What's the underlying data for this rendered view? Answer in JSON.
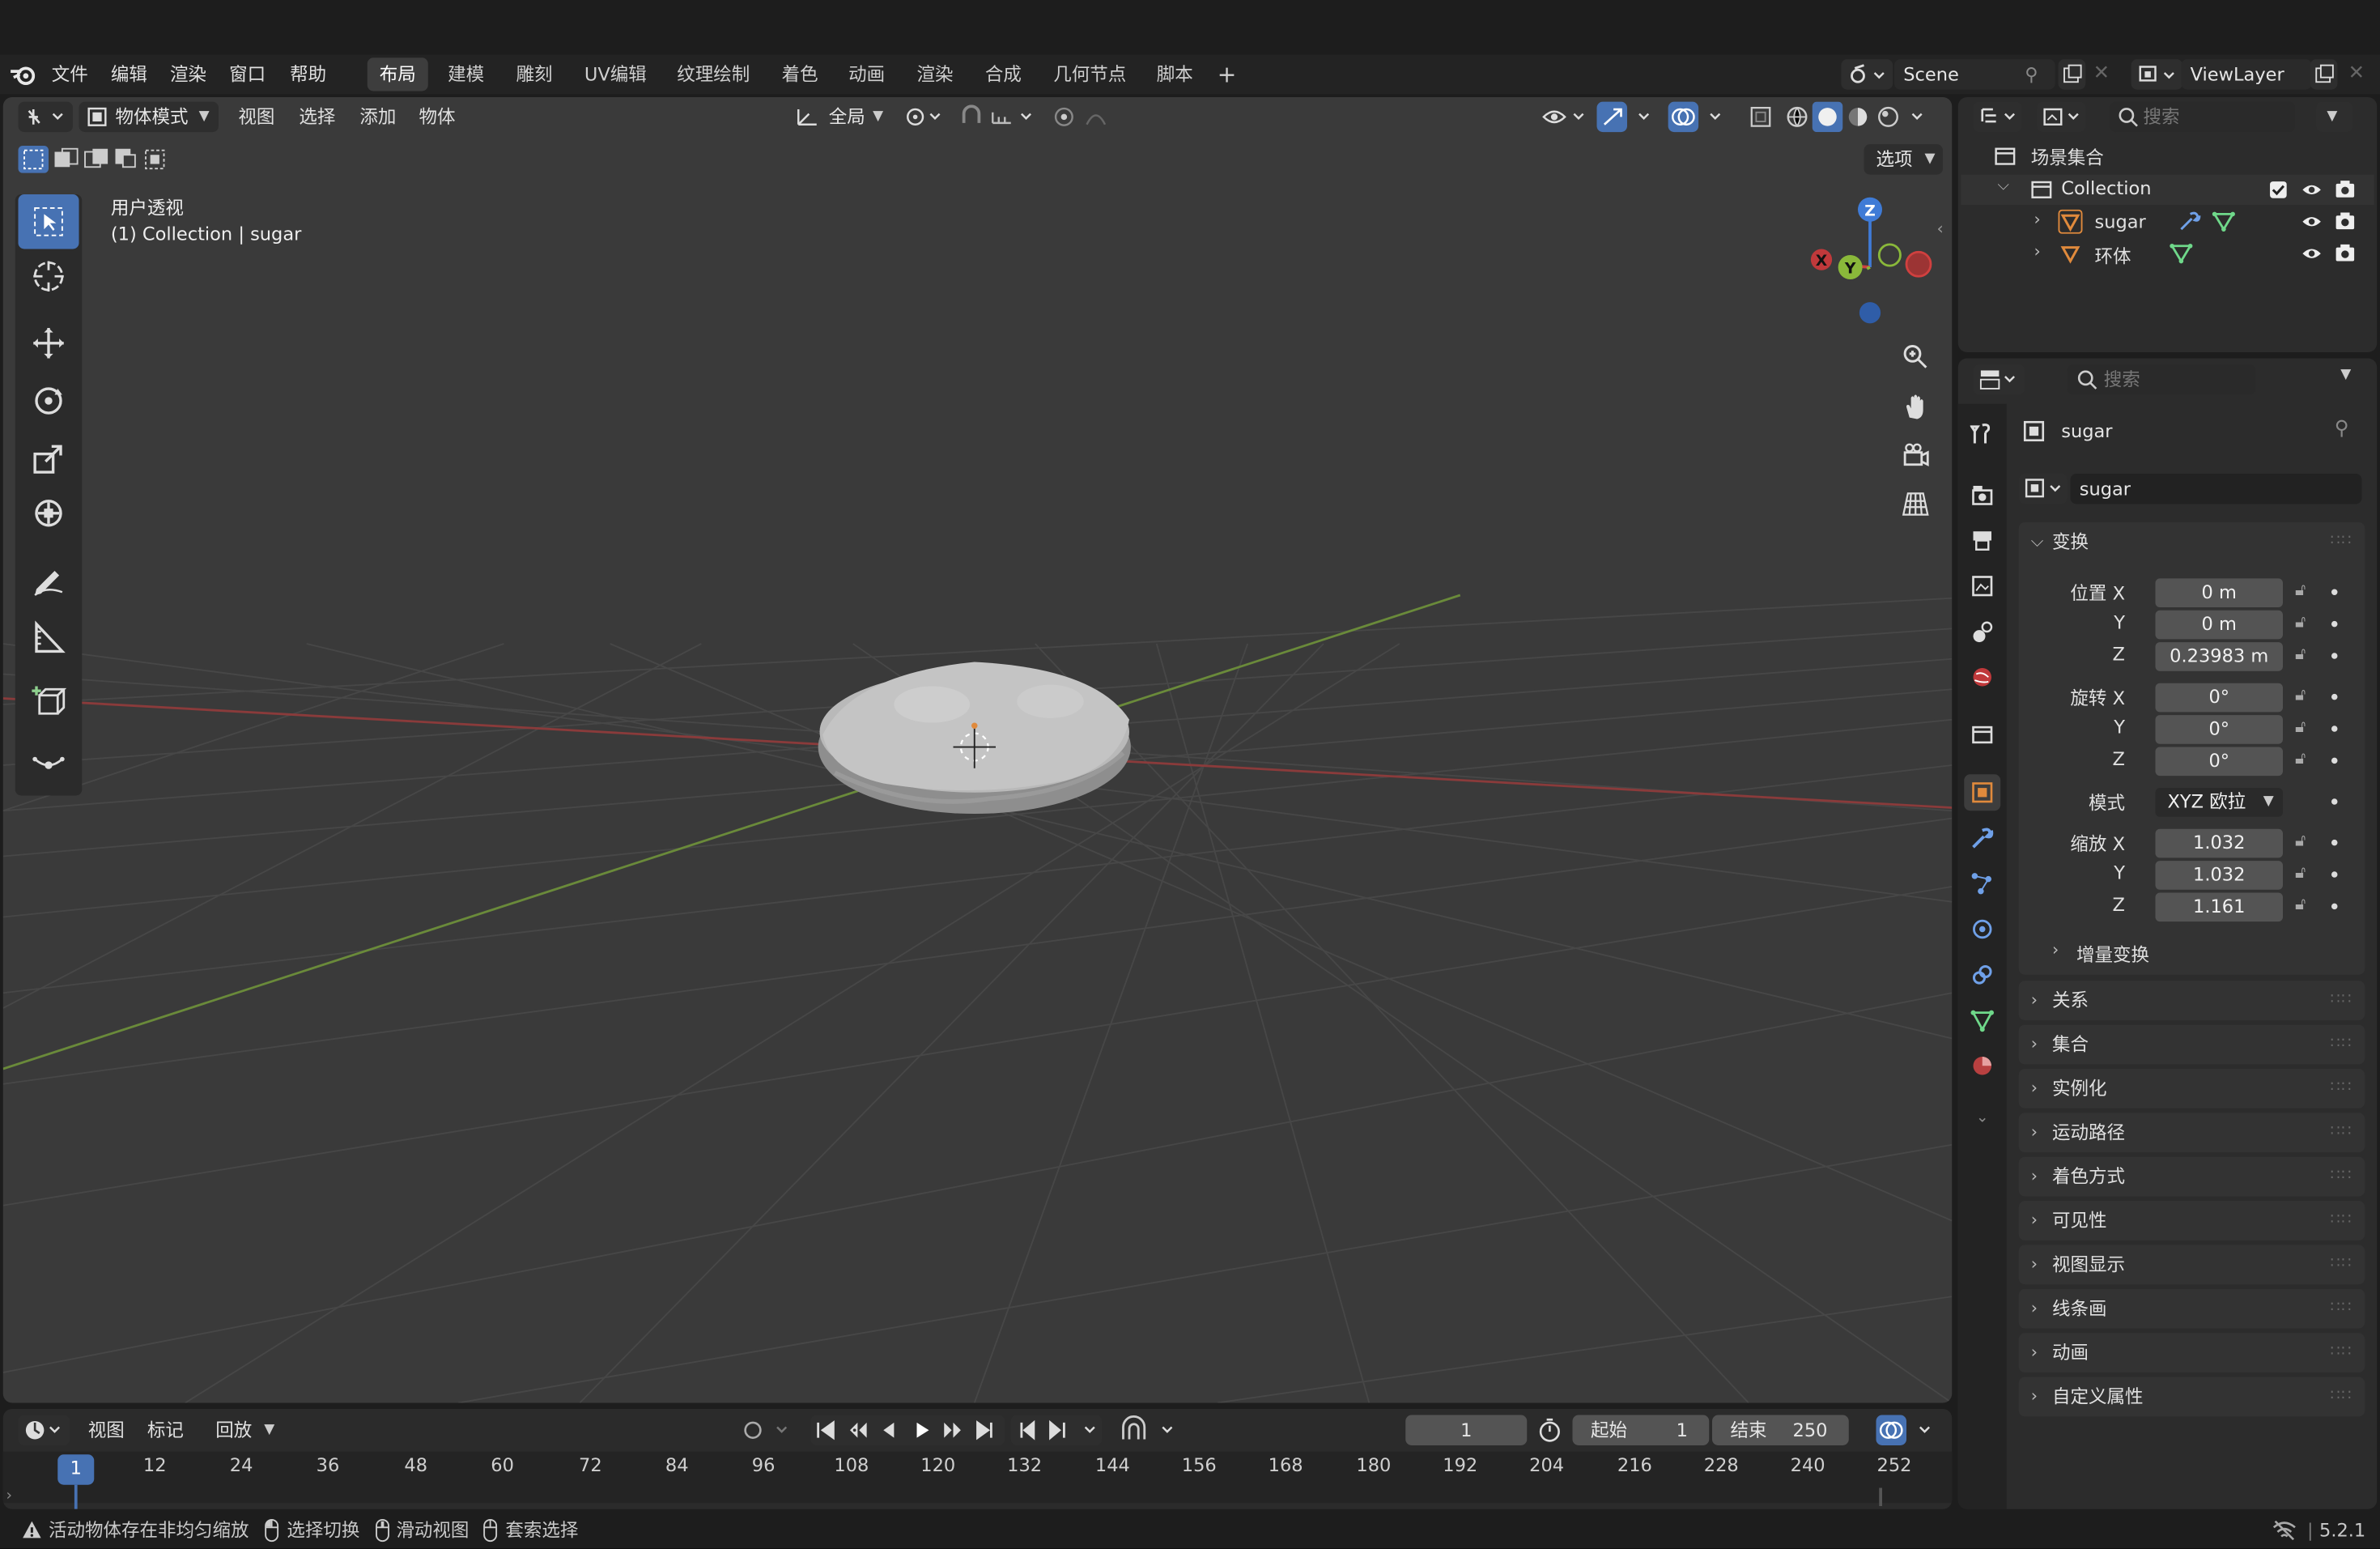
{
  "topbar": {
    "menus": [
      "文件",
      "编辑",
      "渲染",
      "窗口",
      "帮助"
    ],
    "workspaces": [
      "布局",
      "建模",
      "雕刻",
      "UV编辑",
      "纹理绘制",
      "着色",
      "动画",
      "渲染",
      "合成",
      "几何节点",
      "脚本"
    ],
    "add_tab": "+",
    "scene_name": "Scene",
    "view_layer": "ViewLayer"
  },
  "viewport": {
    "mode": "物体模式",
    "menus": [
      "视图",
      "选择",
      "添加",
      "物体"
    ],
    "orientation": "全局",
    "options": "选项",
    "overlay_line1": "用户透视",
    "overlay_line2": "(1) Collection | sugar",
    "gizmo": {
      "x": "X",
      "y": "Y",
      "z": "Z"
    }
  },
  "outliner": {
    "search_placeholder": "搜索",
    "scene_collection": "场景集合",
    "collection": "Collection",
    "items": [
      {
        "name": "sugar"
      },
      {
        "name": "环体"
      }
    ]
  },
  "properties": {
    "search_placeholder": "搜索",
    "object_name": "sugar",
    "object_field": "sugar",
    "transform": {
      "title": "变换",
      "loc_label": "位置 X",
      "loc": [
        "0 m",
        "0 m",
        "0.23983 m"
      ],
      "rot_label": "旋转 X",
      "rot": [
        "0°",
        "0°",
        "0°"
      ],
      "mode_label": "模式",
      "mode_value": "XYZ 欧拉",
      "scale_label": "缩放 X",
      "scale": [
        "1.032",
        "1.032",
        "1.161"
      ],
      "y": "Y",
      "z": "Z",
      "delta": "增量变换"
    },
    "panels": [
      "关系",
      "集合",
      "实例化",
      "运动路径",
      "着色方式",
      "可见性",
      "视图显示",
      "线条画",
      "动画",
      "自定义属性"
    ]
  },
  "timeline": {
    "menus": [
      "视图",
      "标记",
      "回放"
    ],
    "current_frame": "1",
    "start_label": "起始",
    "start": "1",
    "end_label": "结束",
    "end": "250",
    "ticks": [
      "12",
      "24",
      "36",
      "48",
      "60",
      "72",
      "84",
      "96",
      "108",
      "120",
      "132",
      "144",
      "156",
      "168",
      "180",
      "192",
      "204",
      "216",
      "228",
      "240",
      "252"
    ]
  },
  "statusbar": {
    "warning": "活动物体存在非均匀缩放",
    "hint1": "选择切换",
    "hint2": "滑动视图",
    "hint3": "套索选择",
    "version": "5.2.1"
  },
  "colors": {
    "accent": "#4772b3",
    "x_axis": "#d0403f",
    "y_axis": "#8ab83a",
    "z_axis": "#3f7bd6",
    "mesh_tri": "#e08a3c"
  }
}
